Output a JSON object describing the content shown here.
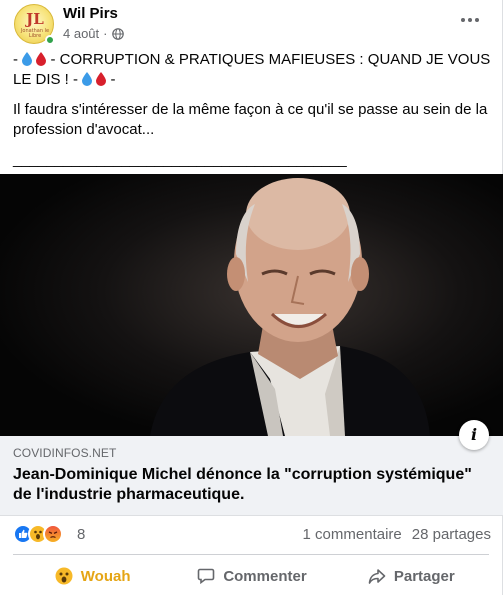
{
  "post": {
    "author": "Wil Pirs",
    "avatar_text": "JL",
    "avatar_subtitle": "Jonathan le Libre",
    "date": "4 août",
    "privacy_dot": "·",
    "text_line1_prefix": "- ",
    "text_line1_main": " - CORRUPTION & PRATIQUES MAFIEUSES : QUAND JE VOUS LE DIS ! - ",
    "text_line1_suffix": " -",
    "text_body": "Il faudra s'intéresser de la même façon à ce qu'il se passe au sein de la profession d'avocat...",
    "separator": "________________________________________"
  },
  "link": {
    "domain": "COVIDINFOS.NET",
    "headline": "Jean-Dominique Michel dénonce la \"corruption systémique\" de l'industrie pharmaceutique.",
    "info_label": "i"
  },
  "reactions": {
    "types": [
      "like",
      "wow",
      "angry"
    ],
    "count": "8",
    "comments": "1 commentaire",
    "shares": "28 partages"
  },
  "actions": {
    "reaction": "Wouah",
    "comment": "Commenter",
    "share": "Partager"
  },
  "colors": {
    "accent": "#1877f2",
    "wow": "#e5a515",
    "secondary_text": "#65676b",
    "drop_blue": "#3b9be8",
    "drop_red": "#d8202c"
  }
}
